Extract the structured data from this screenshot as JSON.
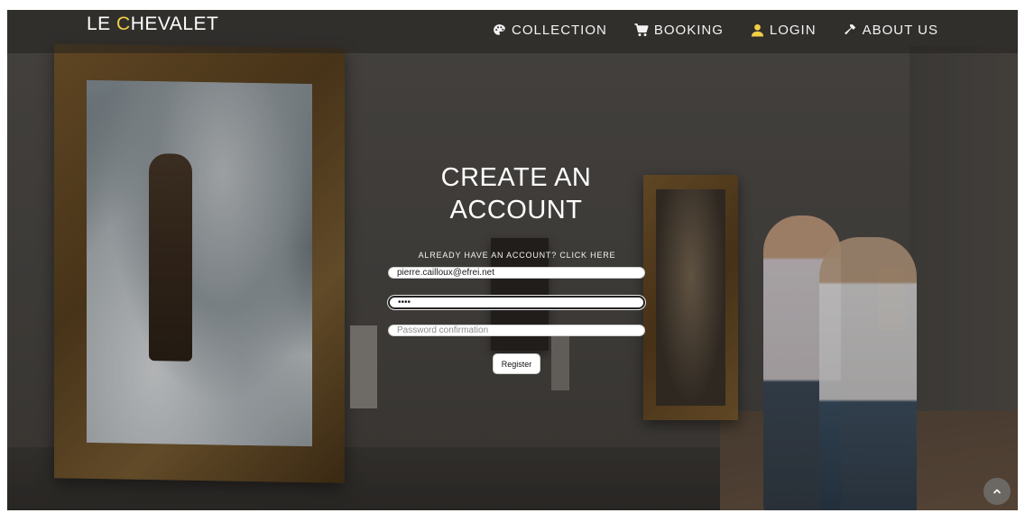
{
  "brand": {
    "part1": "LE ",
    "part2": "C",
    "part3": "HEVALET"
  },
  "nav": [
    {
      "label": "COLLECTION",
      "icon": "palette-icon"
    },
    {
      "label": "BOOKING",
      "icon": "cart-icon"
    },
    {
      "label": "LOGIN",
      "icon": "user-icon"
    },
    {
      "label": "ABOUT US",
      "icon": "hammer-icon"
    }
  ],
  "form": {
    "title_line1": "CREATE AN",
    "title_line2": "ACCOUNT",
    "already_link": "ALREADY HAVE AN ACCOUNT? CLICK HERE",
    "email_value": "pierre.cailloux@efrei.net",
    "password_value": "abcd",
    "confirm_placeholder": "Password confirmation",
    "register_label": "Register"
  },
  "colors": {
    "brand_accent": "#f1cf46",
    "login_icon": "#f1cf46",
    "nav_text": "#f3f3f3"
  },
  "icons": {
    "scroll_top": "chevron-up-icon"
  }
}
